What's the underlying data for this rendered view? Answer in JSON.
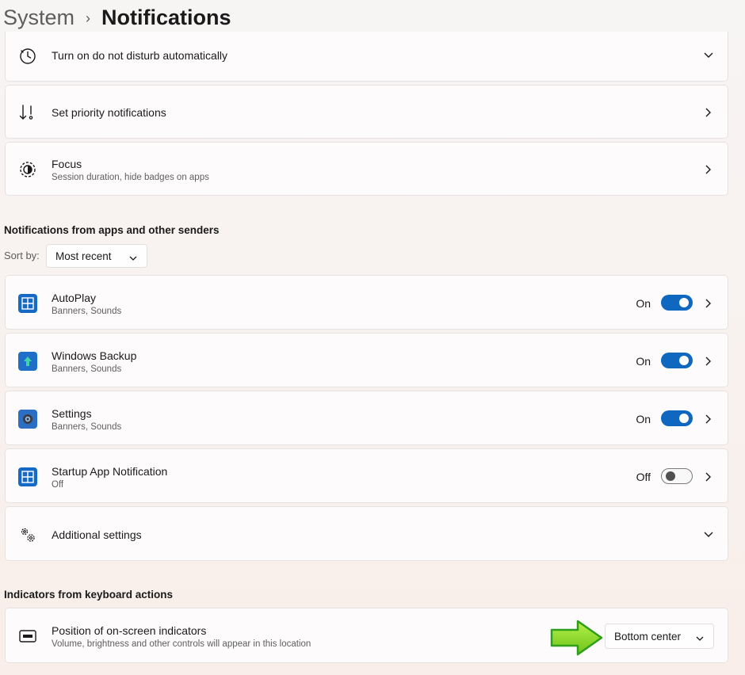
{
  "breadcrumb": {
    "parent": "System",
    "separator": "›",
    "current": "Notifications"
  },
  "top_cards": [
    {
      "title": "Turn on do not disturb automatically",
      "icon": "clock-icon"
    },
    {
      "title": "Set priority notifications",
      "icon": "priority-sort-icon"
    },
    {
      "title": "Focus",
      "subtitle": "Session duration, hide badges on apps",
      "icon": "focus-icon"
    }
  ],
  "apps_section": {
    "title": "Notifications from apps and other senders",
    "sort_label": "Sort by:",
    "sort_value": "Most recent",
    "apps": [
      {
        "name": "AutoPlay",
        "subtitle": "Banners, Sounds",
        "state": "On",
        "enabled": true,
        "icon": "autoplay-icon"
      },
      {
        "name": "Windows Backup",
        "subtitle": "Banners, Sounds",
        "state": "On",
        "enabled": true,
        "icon": "windows-backup-icon"
      },
      {
        "name": "Settings",
        "subtitle": "Banners, Sounds",
        "state": "On",
        "enabled": true,
        "icon": "settings-gear-icon"
      },
      {
        "name": "Startup App Notification",
        "subtitle": "Off",
        "state": "Off",
        "enabled": false,
        "icon": "startup-app-icon"
      }
    ],
    "additional": {
      "title": "Additional settings",
      "icon": "gears-icon"
    }
  },
  "indicators_section": {
    "title": "Indicators from keyboard actions",
    "position": {
      "title": "Position of on-screen indicators",
      "subtitle": "Volume, brightness and other controls will appear in this location",
      "value": "Bottom center",
      "icon": "display-indicator-icon"
    }
  },
  "colors": {
    "accent": "#0f67c0",
    "arrow": "#7ed321",
    "arrow_outline": "#2e9e1b"
  }
}
